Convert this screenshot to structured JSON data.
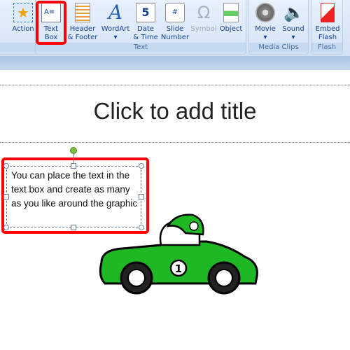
{
  "ribbon": {
    "links_group": {
      "label": "ks",
      "action_label": "Action"
    },
    "text_group": {
      "label": "Text",
      "buttons": [
        {
          "label1": "Text",
          "label2": "Box",
          "icon": "text-box-icon"
        },
        {
          "label1": "Header",
          "label2": "& Footer",
          "icon": "header-footer-icon"
        },
        {
          "label1": "WordArt",
          "label2": "▾",
          "icon": "wordart-icon"
        },
        {
          "label1": "Date",
          "label2": "& Time",
          "icon": "date-time-icon"
        },
        {
          "label1": "Slide",
          "label2": "Number",
          "icon": "slide-number-icon"
        },
        {
          "label1": "Symbol",
          "label2": "",
          "icon": "omega-icon"
        },
        {
          "label1": "Object",
          "label2": "",
          "icon": "object-icon"
        }
      ]
    },
    "media_group": {
      "label": "Media Clips",
      "buttons": [
        {
          "label1": "Movie",
          "label2": "▾"
        },
        {
          "label1": "Sound",
          "label2": "▾"
        }
      ]
    },
    "flash_group": {
      "label": "Flash",
      "button": {
        "label1": "Embed",
        "label2": "Flash"
      }
    }
  },
  "slide": {
    "title_placeholder": "Click to add title",
    "textbox_text": "You can place the text in the text box and create as many as you like around the graphic",
    "car_number": "1"
  },
  "colors": {
    "highlight": "#ff0000",
    "car": "#1fb825"
  }
}
